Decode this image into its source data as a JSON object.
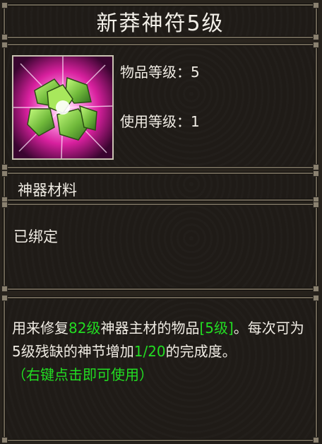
{
  "item": {
    "name": "新莽神符5级",
    "icon": "green-crystal-talisman-icon",
    "stats": {
      "item_level_label": "物品等级：",
      "item_level_value": "5",
      "use_level_label": "使用等级：",
      "use_level_value": "1"
    },
    "type": "神器材料",
    "binding": "已绑定",
    "description": {
      "p1": "用来修复",
      "hl1": "82级",
      "p2": "神器主材的物品",
      "hl2": "[5级]",
      "p3": "。每次可为5级残缺的神节增加",
      "hl3": "1/20",
      "p4": "的完成度。",
      "use_hint": "（右键点击即可使用）"
    }
  },
  "colors": {
    "highlight": "#22dd22",
    "text": "#f0ece4",
    "border": "#6b6354",
    "background": "#221e19"
  }
}
